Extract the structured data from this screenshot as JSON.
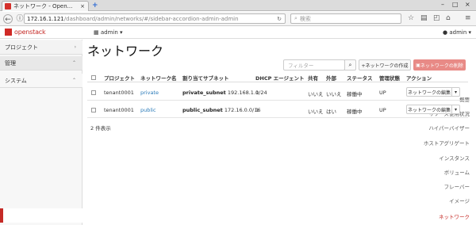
{
  "browser": {
    "tab_title": "ネットワーク - Open...",
    "close": "×",
    "new_tab": "+",
    "win_min": "–",
    "win_max": "□",
    "win_close": "×",
    "url_host": "172.16.1.121",
    "url_path": "/dashboard/admin/networks/#/sidebar-accordion-admin-admin",
    "search_placeholder": "検索"
  },
  "header": {
    "logo": "openstack",
    "project": "admin ▾",
    "user": "admin ▾"
  },
  "sidebar": {
    "sections": [
      {
        "label": "プロジェクト",
        "caret": "›"
      },
      {
        "label": "管理",
        "caret": "⌃"
      },
      {
        "label": "システム",
        "caret": "⌃"
      }
    ],
    "items": [
      "概要",
      "リソース使用状況",
      "ハイパーバイザー",
      "ホストアグリゲート",
      "インスタンス",
      "ボリューム",
      "フレーバー",
      "イメージ",
      "ネットワーク"
    ]
  },
  "main": {
    "title": "ネットワーク",
    "filter_placeholder": "フィルター",
    "filter_icon": "search-icon",
    "create_label": "+ネットワークの作成",
    "delete_label": "ネットワークの削除",
    "columns": [
      "プロジェクト",
      "ネットワーク名",
      "割り当てサブネット",
      "DHCP エージェント",
      "共有",
      "外部",
      "ステータス",
      "管理状態",
      "アクション"
    ],
    "rows": [
      {
        "project": "tenant0001",
        "name": "private",
        "subnet_name": "private_subnet",
        "subnet_cidr": "192.168.1.0/24",
        "dhcp": "1",
        "shared": "いいえ",
        "external": "いいえ",
        "status": "稼働中",
        "admin_state": "UP",
        "action": "ネットワークの編集"
      },
      {
        "project": "tenant0001",
        "name": "public",
        "subnet_name": "public_subnet",
        "subnet_cidr": "172.16.0.0/16",
        "dhcp": "1",
        "shared": "いいえ",
        "external": "はい",
        "status": "稼働中",
        "admin_state": "UP",
        "action": "ネットワークの編集"
      }
    ],
    "footer": "2 件表示"
  },
  "colors": {
    "brand": "#c52a26",
    "link": "#2a7ab8",
    "delete_bg": "#e88a86"
  }
}
